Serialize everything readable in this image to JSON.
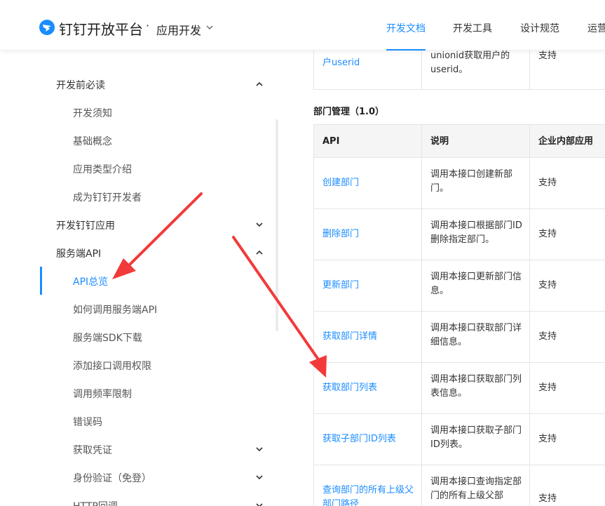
{
  "header": {
    "brand": "钉钉开放平台",
    "separator": "·",
    "section": "应用开发",
    "nav": [
      {
        "label": "开发文档",
        "active": true
      },
      {
        "label": "开发工具",
        "active": false
      },
      {
        "label": "设计规范",
        "active": false
      },
      {
        "label": "运营",
        "active": false
      }
    ]
  },
  "sidebar": {
    "items": [
      {
        "label": "开发前必读",
        "level": 1,
        "chevron": "up"
      },
      {
        "label": "开发须知",
        "level": 2
      },
      {
        "label": "基础概念",
        "level": 2
      },
      {
        "label": "应用类型介绍",
        "level": 2
      },
      {
        "label": "成为钉钉开发者",
        "level": 2
      },
      {
        "label": "开发钉钉应用",
        "level": 1,
        "chevron": "down"
      },
      {
        "label": "服务端API",
        "level": 1,
        "chevron": "up"
      },
      {
        "label": "API总览",
        "level": 2,
        "active": true
      },
      {
        "label": "如何调用服务端API",
        "level": 2
      },
      {
        "label": "服务端SDK下载",
        "level": 2
      },
      {
        "label": "添加接口调用权限",
        "level": 2
      },
      {
        "label": "调用频率限制",
        "level": 2
      },
      {
        "label": "错误码",
        "level": 2
      },
      {
        "label": "获取凭证",
        "level": 2,
        "chevron": "down"
      },
      {
        "label": "身份验证（免登）",
        "level": 2,
        "chevron": "down"
      },
      {
        "label": "HTTP回调",
        "level": 2,
        "chevron": "down"
      }
    ]
  },
  "main": {
    "prev_row": {
      "api": "户userid",
      "desc": "unionid获取用户的userid。",
      "support": "支持"
    },
    "section_title": "部门管理（1.0）",
    "table_headers": [
      "API",
      "说明",
      "企业内部应用"
    ],
    "rows": [
      {
        "api": "创建部门",
        "desc": "调用本接口创建新部门。",
        "support": "支持"
      },
      {
        "api": "删除部门",
        "desc": "调用本接口根据部门ID删除指定部门。",
        "support": "支持"
      },
      {
        "api": "更新部门",
        "desc": "调用本接口更新部门信息。",
        "support": "支持"
      },
      {
        "api": "获取部门详情",
        "desc": "调用本接口获取部门详细信息。",
        "support": "支持"
      },
      {
        "api": "获取部门列表",
        "desc": "调用本接口获取部门列表信息。",
        "support": "支持"
      },
      {
        "api": "获取子部门ID列表",
        "desc": "调用本接口获取子部门ID列表。",
        "support": "支持"
      },
      {
        "api": "查询部门的所有上级父部门路径",
        "desc": "调用本接口查询指定部门的所有上级父部",
        "support": "支持"
      }
    ]
  },
  "colors": {
    "accent": "#1a8cff",
    "arrow": "#f23a3a"
  }
}
